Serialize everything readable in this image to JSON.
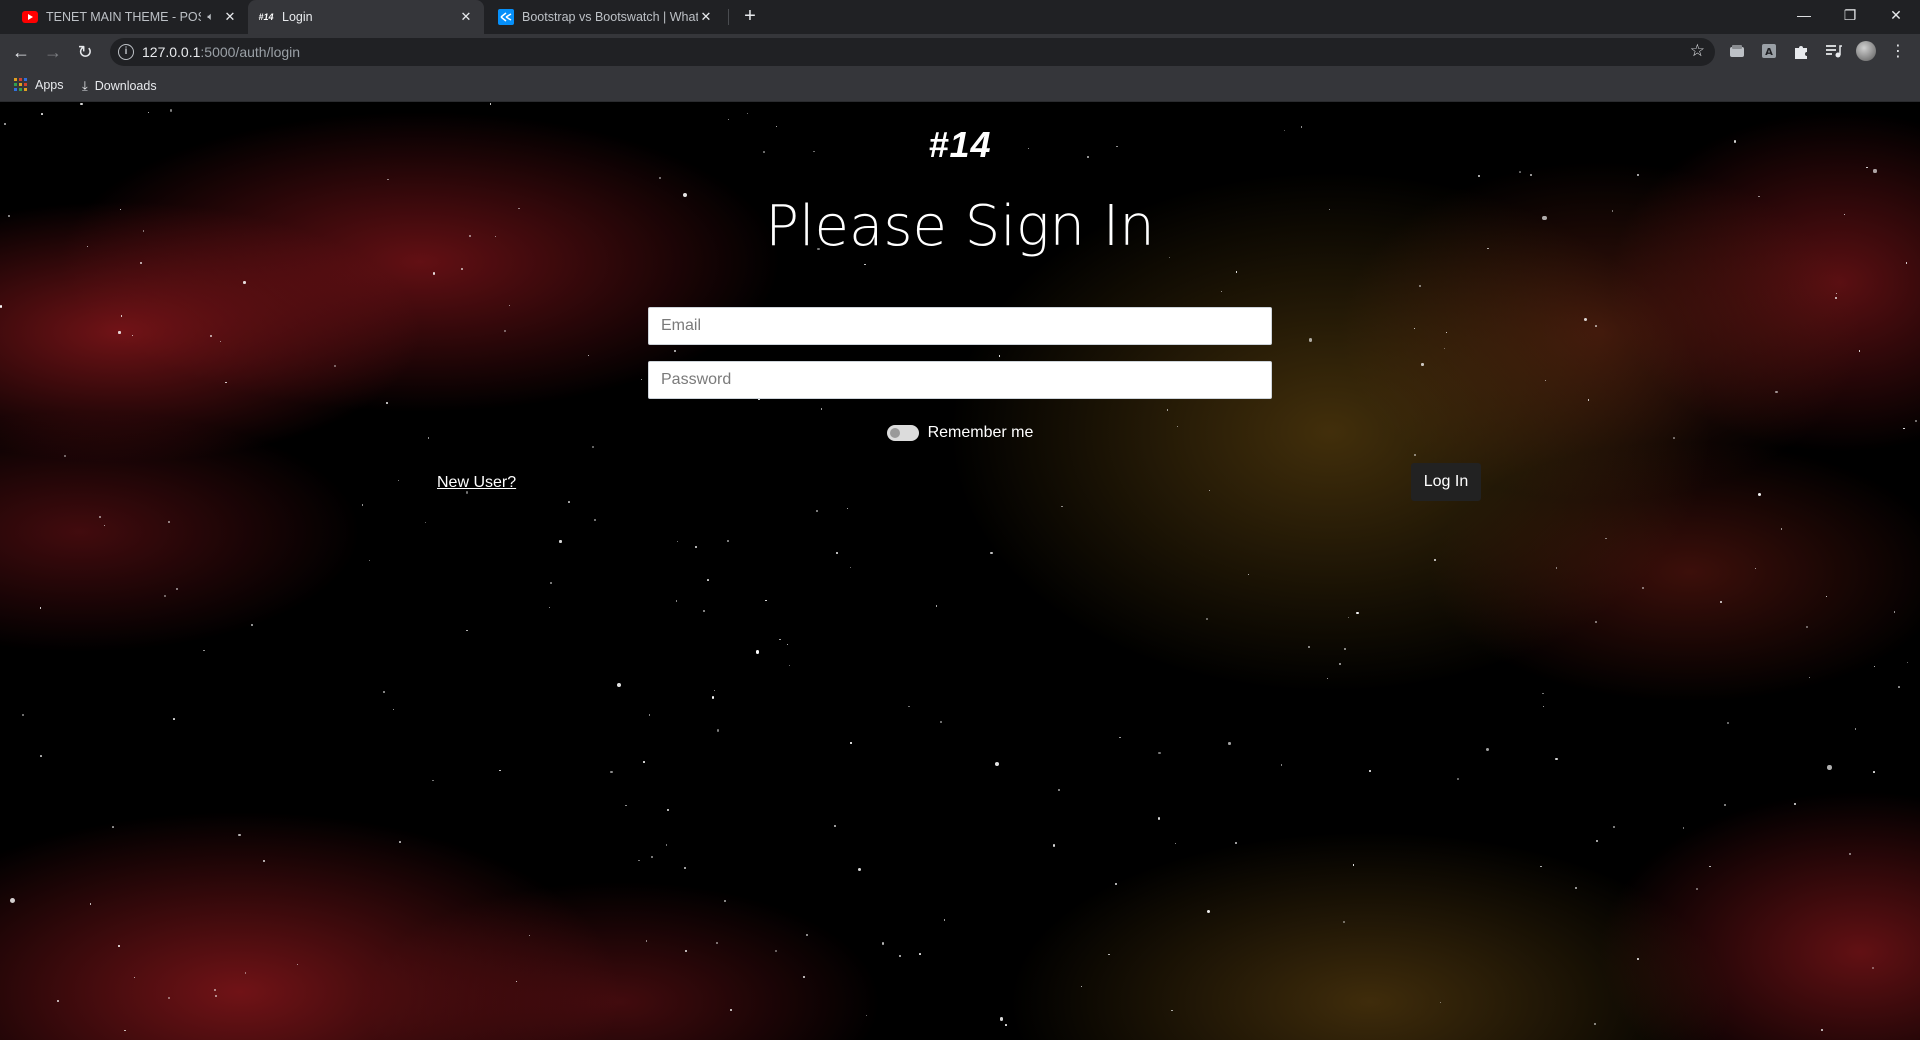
{
  "browser": {
    "tabs": [
      {
        "title": "TENET MAIN THEME - POSTI",
        "favicon": "youtube-icon",
        "active": false,
        "audio": true
      },
      {
        "title": "Login",
        "favicon": "#14",
        "active": true,
        "audio": false
      },
      {
        "title": "Bootstrap vs Bootswatch | What",
        "favicon": "stackshare-icon",
        "active": false,
        "audio": false
      }
    ],
    "url_host": "127.0.0.1",
    "url_rest": ":5000/auth/login",
    "bookmarks": [
      {
        "label": "Apps",
        "icon": "apps-grid-icon"
      },
      {
        "label": "Downloads",
        "icon": "download-icon"
      }
    ]
  },
  "page": {
    "brand": "#14",
    "heading": "Please Sign In",
    "email_placeholder": "Email",
    "password_placeholder": "Password",
    "remember_label": "Remember me",
    "new_user_link": "New User?",
    "login_button": "Log In"
  },
  "colors": {
    "chrome_dark": "#202124",
    "chrome_toolbar": "#35363a",
    "page_bg": "#000000",
    "nebula_red": "#961a1e",
    "nebula_gold": "#78551a",
    "button_bg": "#222222"
  }
}
